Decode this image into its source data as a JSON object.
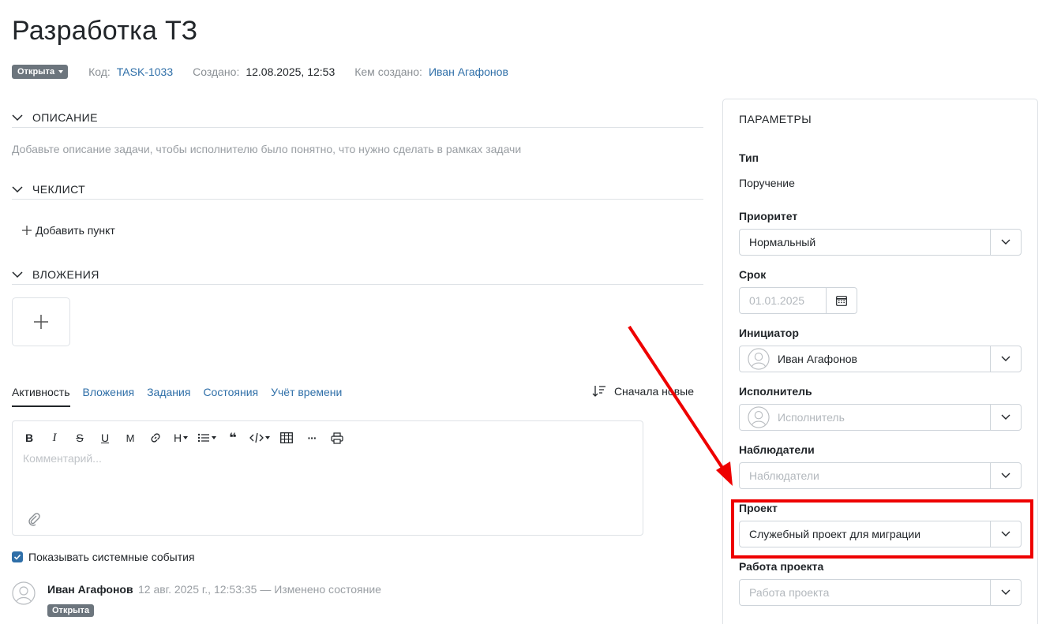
{
  "title": "Разработка ТЗ",
  "meta": {
    "status": "Открыта",
    "code_label": "Код:",
    "code_value": "TASK-1033",
    "created_label": "Создано:",
    "created_value": "12.08.2025, 12:53",
    "author_label": "Кем создано:",
    "author_value": "Иван Агафонов"
  },
  "sections": {
    "description": "ОПИСАНИЕ",
    "description_hint": "Добавьте описание задачи, чтобы исполнителю было понятно, что нужно сделать в рамках задачи",
    "checklist": "ЧЕКЛИСТ",
    "add_item": "Добавить пункт",
    "attachments": "ВЛОЖЕНИЯ"
  },
  "tabs": [
    "Активность",
    "Вложения",
    "Задания",
    "Состояния",
    "Учёт времени"
  ],
  "sort_label": "Сначала новые",
  "editor": {
    "toolbar": {
      "bold": "B",
      "italic": "I",
      "strike": "S",
      "underline": "U",
      "mono": "M",
      "heading": "H",
      "quote": "❝",
      "more": "···"
    },
    "placeholder": "Комментарий..."
  },
  "show_system_events": "Показывать системные события",
  "activity": {
    "author": "Иван Агафонов",
    "meta": "12 авг. 2025 г., 12:53:35 — Изменено состояние",
    "badge": "Открыта"
  },
  "panel": {
    "title": "ПАРАМЕТРЫ",
    "type_label": "Тип",
    "type_value": "Поручение",
    "priority_label": "Приоритет",
    "priority_value": "Нормальный",
    "due_label": "Срок",
    "due_placeholder": "01.01.2025",
    "initiator_label": "Инициатор",
    "initiator_value": "Иван Агафонов",
    "assignee_label": "Исполнитель",
    "assignee_placeholder": "Исполнитель",
    "watchers_label": "Наблюдатели",
    "watchers_placeholder": "Наблюдатели",
    "project_label": "Проект",
    "project_value": "Служебный проект для миграции",
    "project_work_label": "Работа проекта",
    "project_work_placeholder": "Работа проекта"
  },
  "colors": {
    "link": "#2f6fa8",
    "badge": "#6c757d",
    "annotation": "#ee0000"
  }
}
